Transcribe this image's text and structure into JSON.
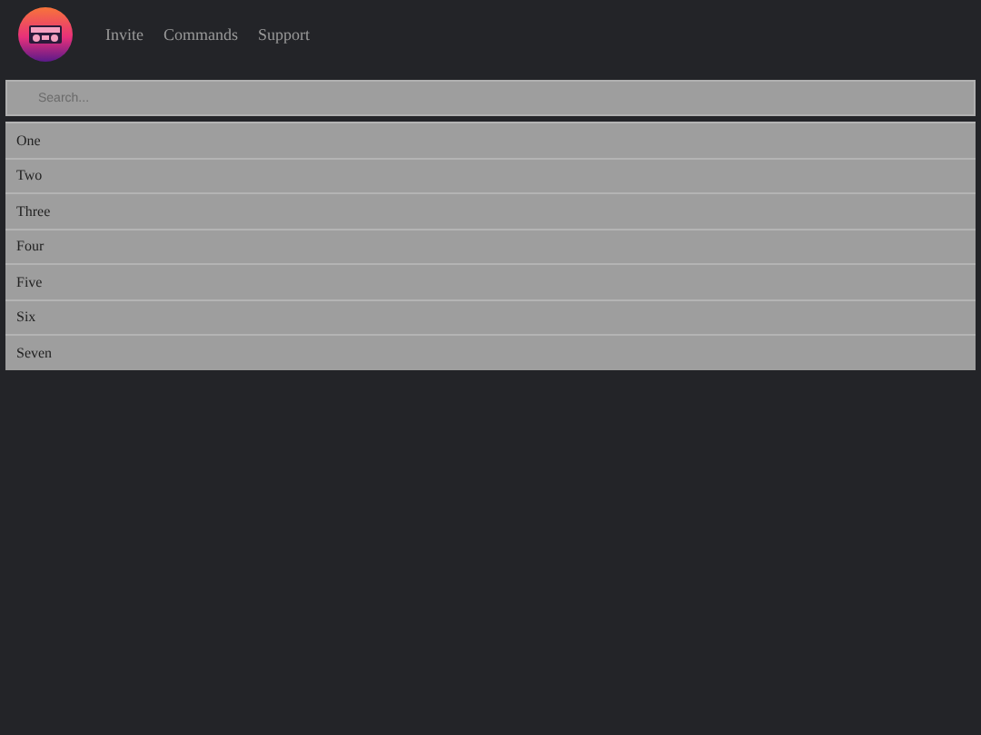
{
  "nav": {
    "links": [
      "Invite",
      "Commands",
      "Support"
    ]
  },
  "search": {
    "placeholder": "Search..."
  },
  "items": [
    "One",
    "Two",
    "Three",
    "Four",
    "Five",
    "Six",
    "Seven"
  ]
}
